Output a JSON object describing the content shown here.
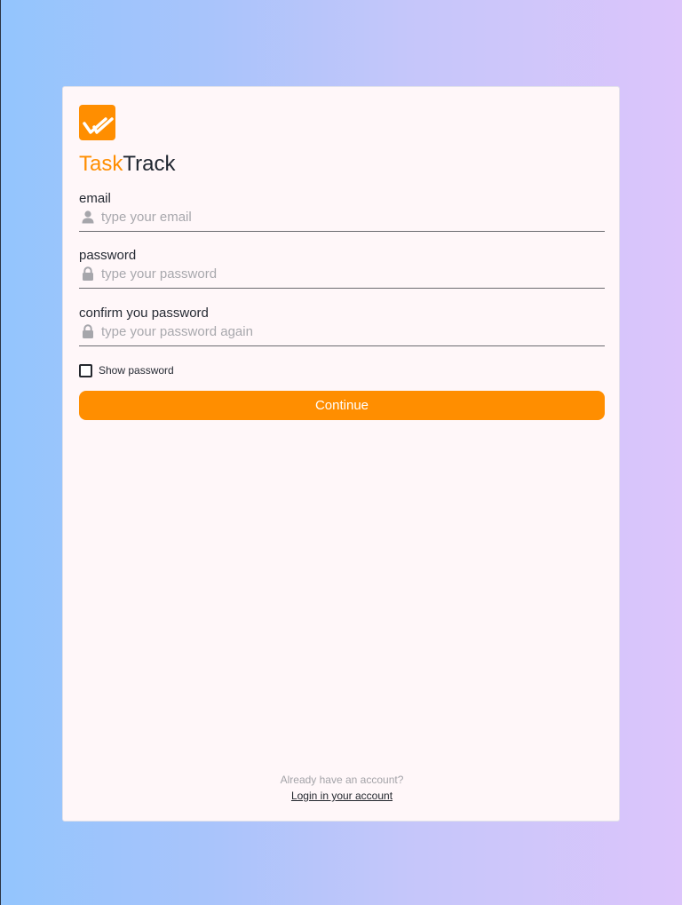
{
  "brand": {
    "part1": "Task",
    "part2": "Track",
    "accent_color": "#ff8e00",
    "logo_icon": "double-check-icon"
  },
  "form": {
    "email": {
      "label": "email",
      "placeholder": "type your email",
      "icon": "user-icon"
    },
    "password": {
      "label": "password",
      "placeholder": "type your password",
      "icon": "lock-icon"
    },
    "confirm": {
      "label": "confirm you password",
      "placeholder": "type your password again",
      "icon": "lock-icon"
    },
    "show_password": {
      "label": "Show password",
      "checked": false
    },
    "submit_label": "Continue"
  },
  "footer": {
    "prompt": "Already have an account?",
    "link": "Login in your account"
  }
}
